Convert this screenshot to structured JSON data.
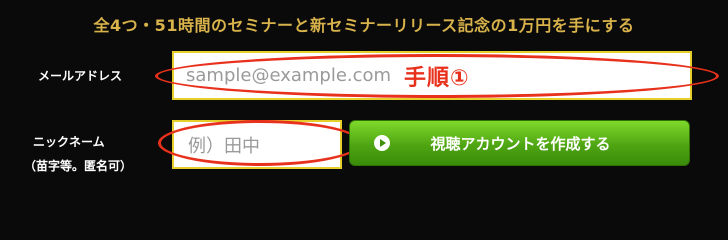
{
  "headline": "全4つ・51時間のセミナーと新セミナーリリース記念の1万円を手にする",
  "form": {
    "email_label": "メールアドレス",
    "email_placeholder": "sample@example.com",
    "nickname_label": "ニックネーム",
    "nickname_sublabel": "（苗字等。匿名可）",
    "nickname_placeholder": "例）田中",
    "submit_label": "視聴アカウントを作成する",
    "submit_icon": "play-circle-icon"
  },
  "annotation": {
    "text": "手順①",
    "color": "#e8311c"
  },
  "colors": {
    "background": "#0a0a0a",
    "headline": "#d8b24a",
    "field_border": "#e6cf2a",
    "button_green": "#4ea512"
  }
}
